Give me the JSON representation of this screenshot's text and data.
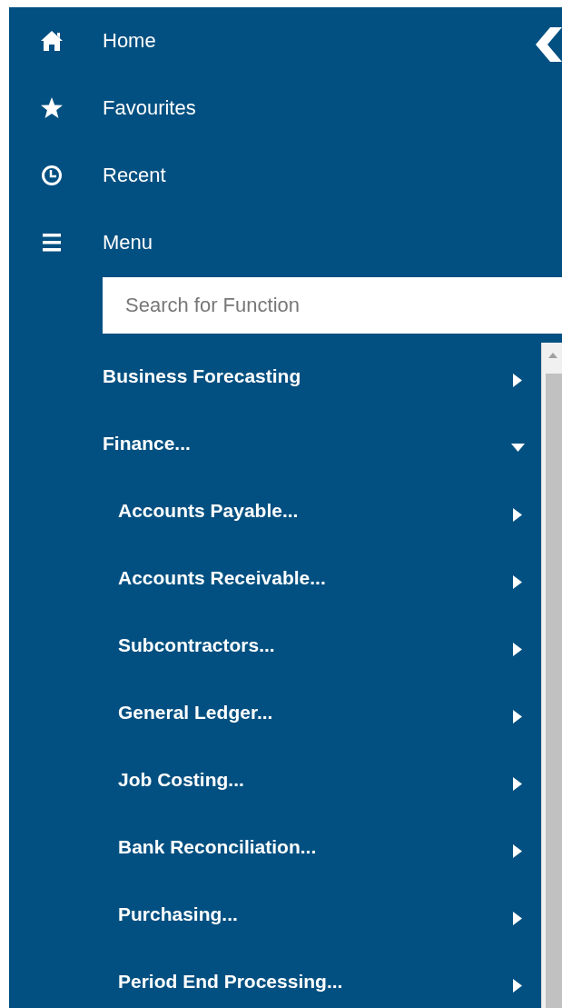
{
  "nav": [
    {
      "kind": "home",
      "label": "Home"
    },
    {
      "kind": "favourites",
      "label": "Favourites"
    },
    {
      "kind": "recent",
      "label": "Recent"
    },
    {
      "kind": "menu",
      "label": "Menu"
    }
  ],
  "search": {
    "placeholder": "Search for Function"
  },
  "menu_items": [
    {
      "label": "Business Forecasting",
      "expanded": false
    },
    {
      "label": "Finance...",
      "expanded": true,
      "children": [
        {
          "label": "Accounts Payable...",
          "expanded": false
        },
        {
          "label": "Accounts Receivable...",
          "expanded": false
        },
        {
          "label": "Subcontractors...",
          "expanded": false
        },
        {
          "label": "General Ledger...",
          "expanded": false
        },
        {
          "label": "Job Costing...",
          "expanded": false
        },
        {
          "label": "Bank Reconciliation...",
          "expanded": false
        },
        {
          "label": "Purchasing...",
          "expanded": false
        },
        {
          "label": "Period End Processing...",
          "expanded": false
        }
      ]
    }
  ]
}
